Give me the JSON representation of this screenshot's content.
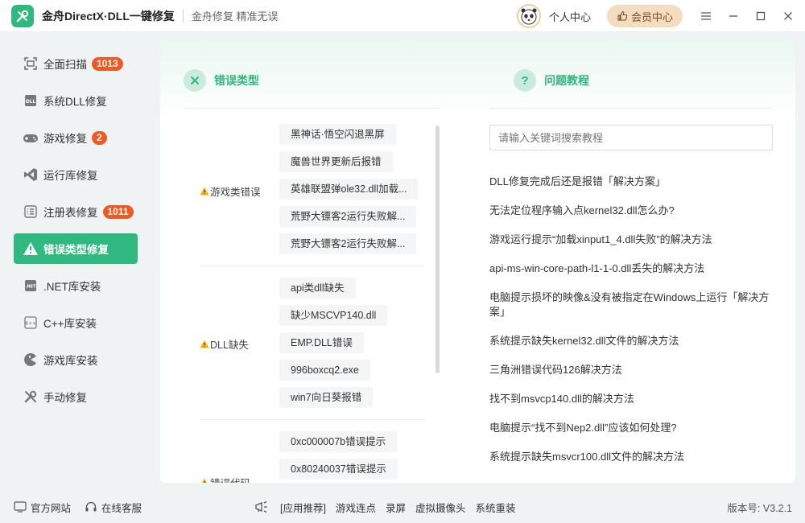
{
  "app": {
    "title": "金舟DirectX·DLL一键修复",
    "slogan": "金舟修复 精准无误",
    "personal_center": "个人中心",
    "vip_center": "会员中心"
  },
  "sidebar": {
    "items": [
      {
        "label": "全面扫描",
        "badge": "1013",
        "icon": "scan-icon"
      },
      {
        "label": "系统DLL修复",
        "badge": "",
        "icon": "dll-icon"
      },
      {
        "label": "游戏修复",
        "badge": "2",
        "icon": "gamepad-icon"
      },
      {
        "label": "运行库修复",
        "badge": "",
        "icon": "vs-icon"
      },
      {
        "label": "注册表修复",
        "badge": "1011",
        "icon": "registry-icon"
      },
      {
        "label": "错误类型修复",
        "badge": "",
        "icon": "warning-icon"
      },
      {
        "label": ".NET库安装",
        "badge": "",
        "icon": "net-icon"
      },
      {
        "label": "C++库安装",
        "badge": "",
        "icon": "cpp-icon"
      },
      {
        "label": "游戏库安装",
        "badge": "",
        "icon": "pacman-icon"
      },
      {
        "label": "手动修复",
        "badge": "",
        "icon": "tools-icon"
      }
    ]
  },
  "error_types": {
    "title": "错误类型",
    "groups": [
      {
        "label": "游戏类错误",
        "items": [
          "黑神话·悟空闪退黑屏",
          "魔兽世界更新后报错",
          "英雄联盟弹ole32.dll加载...",
          "荒野大镖客2运行失败解...",
          "荒野大镖客2运行失败解..."
        ]
      },
      {
        "label": "DLL缺失",
        "items": [
          "api类dll缺失",
          "缺少MSCVP140.dll",
          "EMP.DLL错误",
          "996boxcq2.exe",
          "win7向日葵报错"
        ]
      },
      {
        "label": "错误代码",
        "items": [
          "0xc000007b错误提示",
          "0x80240037错误提示"
        ]
      }
    ]
  },
  "tutorials": {
    "title": "问题教程",
    "search_placeholder": "请输入关键词搜索教程",
    "items": [
      "DLL修复完成后还是报错「解决方案」",
      "无法定位程序输入点kernel32.dll怎么办?",
      "游戏运行提示“加载xinput1_4.dll失败”的解决方法",
      "api-ms-win-core-path-l1-1-0.dll丢失的解决方法",
      "电脑提示损坏的映像&没有被指定在Windows上运行「解决方案」",
      "系统提示缺失kernel32.dll文件的解决方法",
      "三角洲错误代码126解决方法",
      "找不到msvcp140.dll的解决方法",
      "电脑提示“找不到Nep2.dll”应该如何处理?",
      "系统提示缺失msvcr100.dll文件的解决方法"
    ]
  },
  "bottom": {
    "website": "官方网站",
    "service": "在线客服",
    "apps_label": "[应用推荐]",
    "apps": [
      "游戏连点",
      "录屏",
      "虚拟摄像头",
      "系统重装"
    ],
    "version": "版本号: V3.2.1"
  },
  "colors": {
    "accent": "#2fb87f",
    "badge": "#f05a22",
    "vip": "#f3dcc0"
  }
}
